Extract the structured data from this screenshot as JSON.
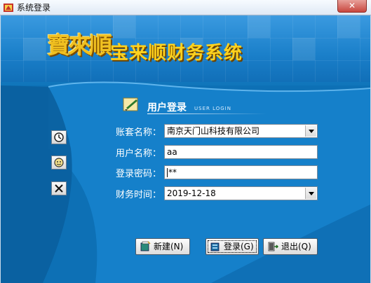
{
  "window": {
    "title": "系统登录",
    "close_label": "✕"
  },
  "banner": {
    "logo_text": "寶來順",
    "system_name": "宝来顺财务系统"
  },
  "login": {
    "title": "用户登录",
    "subtitle": "USER LOGIN",
    "fields": {
      "account_label": "账套名称：",
      "account_value": "南京天门山科技有限公司",
      "user_label": "用户名称：",
      "user_value": "aa",
      "password_label": "登录密码：",
      "password_value": "**",
      "date_label": "财务时间：",
      "date_value": "2019-12-18"
    }
  },
  "buttons": {
    "new_label": "新建(N)",
    "login_label": "登录(G)",
    "exit_label": "退出(Q)"
  },
  "icons": {
    "app": "app-logo-icon",
    "header": "login-note-icon",
    "side": [
      "clock-icon",
      "gear-face-icon",
      "cross-icon"
    ],
    "new": "new-book-icon",
    "login": "login-book-icon",
    "exit": "exit-door-icon"
  },
  "colors": {
    "background": "#0d6fb4",
    "banner_text": "#ffd21e",
    "label_text": "#ffffff"
  }
}
